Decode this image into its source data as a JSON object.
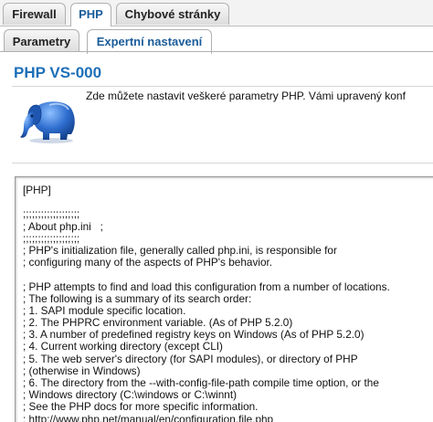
{
  "top_tabs": [
    {
      "label": "Firewall",
      "active": false
    },
    {
      "label": "PHP",
      "active": true
    },
    {
      "label": "Chybové stránky",
      "active": false
    }
  ],
  "sub_tabs": [
    {
      "label": "Parametry",
      "active": false
    },
    {
      "label": "Expertní nastavení",
      "active": true
    }
  ],
  "content": {
    "title": "PHP VS-000",
    "intro": "Zde můžete nastavit veškeré parametry PHP. Vámi upravený konf",
    "logo_icon": "php-elephant-icon"
  },
  "editor": {
    "lines": [
      "[PHP]",
      "",
      ";;;;;;;;;;;;;;;;;;;",
      "; About php.ini   ;",
      ";;;;;;;;;;;;;;;;;;;",
      "; PHP's initialization file, generally called php.ini, is responsible for",
      "; configuring many of the aspects of PHP's behavior.",
      "",
      "; PHP attempts to find and load this configuration from a number of locations.",
      "; The following is a summary of its search order:",
      "; 1. SAPI module specific location.",
      "; 2. The PHPRC environment variable. (As of PHP 5.2.0)",
      "; 3. A number of predefined registry keys on Windows (As of PHP 5.2.0)",
      "; 4. Current working directory (except CLI)",
      "; 5. The web server's directory (for SAPI modules), or directory of PHP",
      "; (otherwise in Windows)",
      "; 6. The directory from the --with-config-file-path compile time option, or the",
      "; Windows directory (C:\\windows or C:\\winnt)",
      "; See the PHP docs for more specific information.",
      "; http://www.php.net/manual/en/configuration.file.php"
    ]
  },
  "colors": {
    "accent": "#1d6fb8",
    "elephant": "#2f6fd0"
  }
}
